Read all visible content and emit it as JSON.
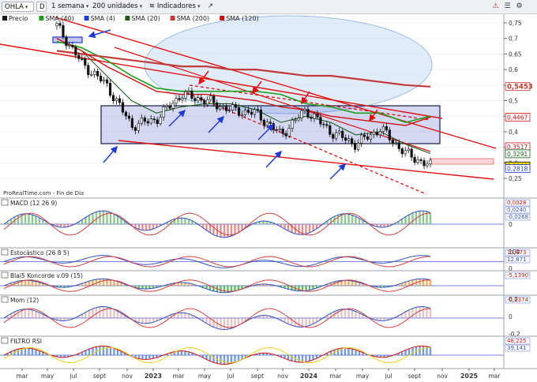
{
  "toolbar": {
    "symbol": "OHLA",
    "d_label": "D",
    "timeframe": "1 semana",
    "units": "200 unidades",
    "indicators": "Indicadores"
  },
  "main": {
    "legend": [
      "Precio",
      "SMA (40)",
      "SMA (4)",
      "SMA (20)",
      "SMA (200)",
      "SMA (120)"
    ],
    "legend_colors": [
      "#1a1a1a",
      "#1e9e1e",
      "#1f3bd6",
      "#1a5c1a",
      "#c23b3b",
      "#d01010"
    ],
    "source": "ProRealTime.com - Fin de Día",
    "ticks": [
      "0,75",
      "0,7",
      "0,65",
      "0,6",
      "0,55",
      "0,5",
      "0,45",
      "0,4",
      "0,35",
      "0,3",
      "0,25"
    ],
    "tags": [
      {
        "text": "0,5453",
        "fg": "#c0392b",
        "bg": "#ffffff",
        "bd": "#c0392b"
      },
      {
        "text": "0,4467",
        "fg": "#d01010",
        "bg": "#ffffff",
        "bd": "#d01010"
      },
      {
        "text": "0,3517",
        "fg": "#d01010",
        "bg": "#ffffff",
        "bd": "#d01010"
      },
      {
        "text": "0,3291",
        "fg": "#1a5c1a",
        "bg": "#ffffff",
        "bd": "#1a5c1a"
      },
      {
        "text": "0,2900",
        "fg": "#000000",
        "bg": "#ffe000",
        "bd": "#000000"
      },
      {
        "text": "0,2818",
        "fg": "#1f3bd6",
        "bg": "#ffffff",
        "bd": "#1f3bd6"
      }
    ]
  },
  "panels": {
    "macd": {
      "title": "MACD (12 26 9)",
      "tags": [
        "0,0028",
        "0,0240",
        "-0,0268"
      ],
      "tick": "0"
    },
    "stoch": {
      "title": "Estocástico (26 8 5)",
      "tags": [
        "13,473",
        "12,871"
      ],
      "ticks": [
        "100",
        "0"
      ]
    },
    "blai": {
      "title": "Blai5 Koncorde v.09 (15)",
      "tags": [
        "-5,1390"
      ]
    },
    "mom": {
      "title": "Mom (12)",
      "tags": [
        "-0,0374"
      ],
      "ticks": [
        "0,2",
        "0",
        "-0,2"
      ]
    },
    "rsi": {
      "title": "FILTRO RSI",
      "tags": [
        "48,225",
        "39,141"
      ]
    }
  },
  "xaxis": [
    "mar",
    "may",
    "jul",
    "sept",
    "nov",
    "2023",
    "mar",
    "may",
    "jul",
    "sept",
    "nov",
    "2024",
    "mar",
    "may",
    "jul",
    "sept",
    "nov",
    "2025",
    "mar"
  ],
  "chart_data": {
    "type": "line",
    "title": "OHLA",
    "xlabel": "",
    "ylabel": "",
    "x": [
      "2022-04",
      "2022-06",
      "2022-08",
      "2022-10",
      "2022-12",
      "2023-02",
      "2023-04",
      "2023-06",
      "2023-08",
      "2023-10",
      "2023-12",
      "2024-02",
      "2024-04",
      "2024-06",
      "2024-08",
      "2024-10"
    ],
    "ylim": [
      0.24,
      0.76
    ],
    "series": [
      {
        "name": "Precio",
        "values": [
          0.74,
          0.62,
          0.55,
          0.42,
          0.44,
          0.52,
          0.5,
          0.47,
          0.46,
          0.39,
          0.47,
          0.4,
          0.36,
          0.41,
          0.33,
          0.29
        ]
      },
      {
        "name": "SMA (40)",
        "values": [
          0.69,
          0.67,
          0.63,
          0.58,
          0.54,
          0.53,
          0.53,
          0.53,
          0.53,
          0.52,
          0.49,
          0.48,
          0.46,
          0.46,
          0.43,
          0.45
        ]
      },
      {
        "name": "SMA (20)",
        "values": [
          0.7,
          0.66,
          0.58,
          0.5,
          0.46,
          0.48,
          0.49,
          0.49,
          0.47,
          0.43,
          0.45,
          0.43,
          0.39,
          0.4,
          0.36,
          0.33
        ]
      },
      {
        "name": "SMA (200)",
        "values": [
          0.66,
          0.65,
          0.64,
          0.63,
          0.62,
          0.61,
          0.61,
          0.6,
          0.6,
          0.59,
          0.58,
          0.58,
          0.57,
          0.56,
          0.55,
          0.545
        ]
      },
      {
        "name": "SMA (120)",
        "values": [
          0.7,
          0.66,
          0.61,
          0.57,
          0.53,
          0.52,
          0.52,
          0.51,
          0.5,
          0.48,
          0.47,
          0.45,
          0.44,
          0.43,
          0.42,
          0.447
        ]
      }
    ],
    "grid": false,
    "legend": "top-left"
  }
}
